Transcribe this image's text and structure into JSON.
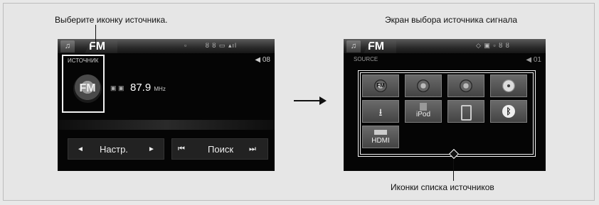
{
  "captions": {
    "left_top": "Выберите иконку источника.",
    "right_top": "Экран выбора источника сигнала",
    "right_bottom": "Иконки списка источников"
  },
  "left_screen": {
    "tab_fm": "FM",
    "source_label": "ИСТОЧНИК",
    "fm_icon_text": "FM",
    "volume": "◀ 08",
    "frequency": "87.9",
    "frequency_unit": "MHz",
    "controls": {
      "tune_label": "Настр.",
      "seek_label": "Поиск",
      "left_arrow": "◄",
      "right_arrow": "►",
      "prev": "⏮",
      "next": "⏭"
    }
  },
  "right_screen": {
    "tab_fm": "FM",
    "source_label": "SOURCE",
    "volume": "◀ 01",
    "sources": [
      {
        "id": "fm",
        "label": "FM"
      },
      {
        "id": "am",
        "label": ""
      },
      {
        "id": "mw",
        "label": ""
      },
      {
        "id": "disc",
        "label": ""
      },
      {
        "id": "usb",
        "label": ""
      },
      {
        "id": "ipod",
        "label": "iPod"
      },
      {
        "id": "phone",
        "label": ""
      },
      {
        "id": "bluetooth",
        "label": ""
      },
      {
        "id": "hdmi",
        "label": "HDMI"
      }
    ]
  },
  "icons": {
    "music": "music-note-icon",
    "arrow": "right-arrow-icon"
  }
}
